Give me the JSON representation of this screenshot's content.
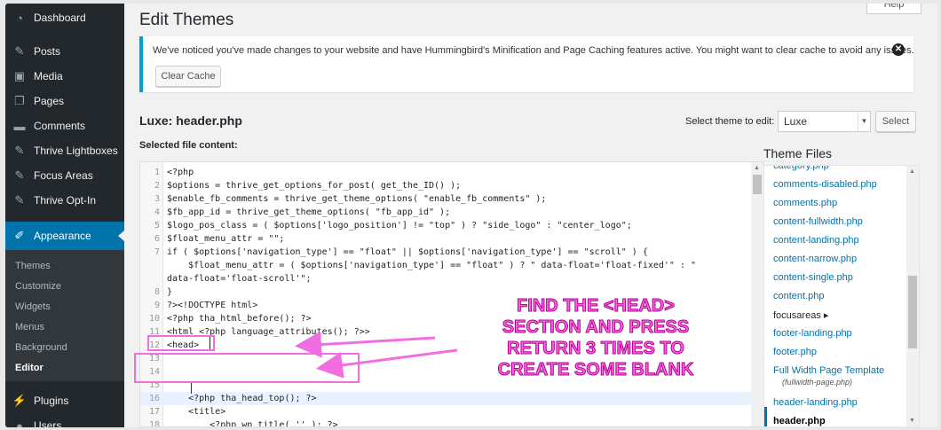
{
  "sidebar": {
    "items": [
      {
        "label": "Dashboard",
        "icon": "gauge-icon"
      },
      {
        "label": "Posts",
        "icon": "pin-icon"
      },
      {
        "label": "Media",
        "icon": "media-icon"
      },
      {
        "label": "Pages",
        "icon": "pages-icon"
      },
      {
        "label": "Comments",
        "icon": "comment-icon"
      },
      {
        "label": "Thrive Lightboxes",
        "icon": "pin-icon"
      },
      {
        "label": "Focus Areas",
        "icon": "pin-icon"
      },
      {
        "label": "Thrive Opt-In",
        "icon": "pin-icon"
      }
    ],
    "active": {
      "label": "Appearance",
      "icon": "brush-icon"
    },
    "submenu": [
      "Themes",
      "Customize",
      "Widgets",
      "Menus",
      "Background",
      "Editor"
    ],
    "bottom_items": [
      {
        "label": "Plugins",
        "icon": "plug-icon"
      },
      {
        "label": "Users",
        "icon": "users-icon"
      }
    ]
  },
  "header": {
    "title": "Edit Themes",
    "help_label": "Help"
  },
  "notice": {
    "text": "We've noticed you've made changes to your website and have Hummingbird's Minification and Page Caching features active. You might want to clear cache to avoid any issues.",
    "button": "Clear Cache"
  },
  "editor": {
    "file_title": "Luxe: header.php",
    "select_label": "Select theme to edit:",
    "selected_theme": "Luxe",
    "select_button": "Select",
    "content_label": "Selected file content:",
    "lines": [
      {
        "n": "1",
        "code": "<?php"
      },
      {
        "n": "2",
        "code": "$options = thrive_get_options_for_post( get_the_ID() );"
      },
      {
        "n": "3",
        "code": "$enable_fb_comments = thrive_get_theme_options( \"enable_fb_comments\" );"
      },
      {
        "n": "4",
        "code": "$fb_app_id = thrive_get_theme_options( \"fb_app_id\" );"
      },
      {
        "n": "5",
        "code": "$logo_pos_class = ( $options['logo_position'] != \"top\" ) ? \"side_logo\" : \"center_logo\";"
      },
      {
        "n": "6",
        "code": "$float_menu_attr = \"\";"
      },
      {
        "n": "7",
        "code": "if ( $options['navigation_type'] == \"float\" || $options['navigation_type'] == \"scroll\" ) {"
      },
      {
        "n": "",
        "code": "    $float_menu_attr = ( $options['navigation_type'] == \"float\" ) ? \" data-float='float-fixed'\" : \""
      },
      {
        "n": "",
        "code": "data-float='float-scroll'\";"
      },
      {
        "n": "8",
        "code": "}"
      },
      {
        "n": "9",
        "code": "?><!DOCTYPE html>"
      },
      {
        "n": "10",
        "code": "<?php tha_html_before(); ?>"
      },
      {
        "n": "11",
        "code": "<html <?php language_attributes(); ?>>"
      },
      {
        "n": "12",
        "code": "<head>"
      },
      {
        "n": "13",
        "code": ""
      },
      {
        "n": "14",
        "code": ""
      },
      {
        "n": "15",
        "code": ""
      },
      {
        "n": "16",
        "code": "    <?php tha_head_top(); ?>"
      },
      {
        "n": "17",
        "code": "    <title>"
      },
      {
        "n": "18",
        "code": "        <?php wp_title( '' ); ?>"
      }
    ]
  },
  "files": {
    "title": "Theme Files",
    "items": [
      {
        "label": "category.php",
        "kind": "file"
      },
      {
        "label": "comments-disabled.php",
        "kind": "file"
      },
      {
        "label": "comments.php",
        "kind": "file"
      },
      {
        "label": "content-fullwidth.php",
        "kind": "file"
      },
      {
        "label": "content-landing.php",
        "kind": "file"
      },
      {
        "label": "content-narrow.php",
        "kind": "file"
      },
      {
        "label": "content-single.php",
        "kind": "file"
      },
      {
        "label": "content.php",
        "kind": "file"
      },
      {
        "label": "focusareas",
        "kind": "dir"
      },
      {
        "label": "footer-landing.php",
        "kind": "file"
      },
      {
        "label": "footer.php",
        "kind": "file"
      },
      {
        "label": "Full Width Page Template",
        "kind": "template",
        "sub": "(fullwidth-page.php)"
      },
      {
        "label": "header-landing.php",
        "kind": "file"
      },
      {
        "label": "header.php",
        "kind": "current"
      }
    ]
  },
  "annotation": {
    "lines": [
      "FIND THE <HEAD>",
      "SECTION AND PRESS",
      "RETURN 3 TIMES TO",
      "CREATE SOME BLANK"
    ],
    "color": "#ff66d9"
  },
  "colors": {
    "sidebar_bg": "#23282d",
    "accent": "#0073aa",
    "notice_border": "#00a0d2"
  }
}
